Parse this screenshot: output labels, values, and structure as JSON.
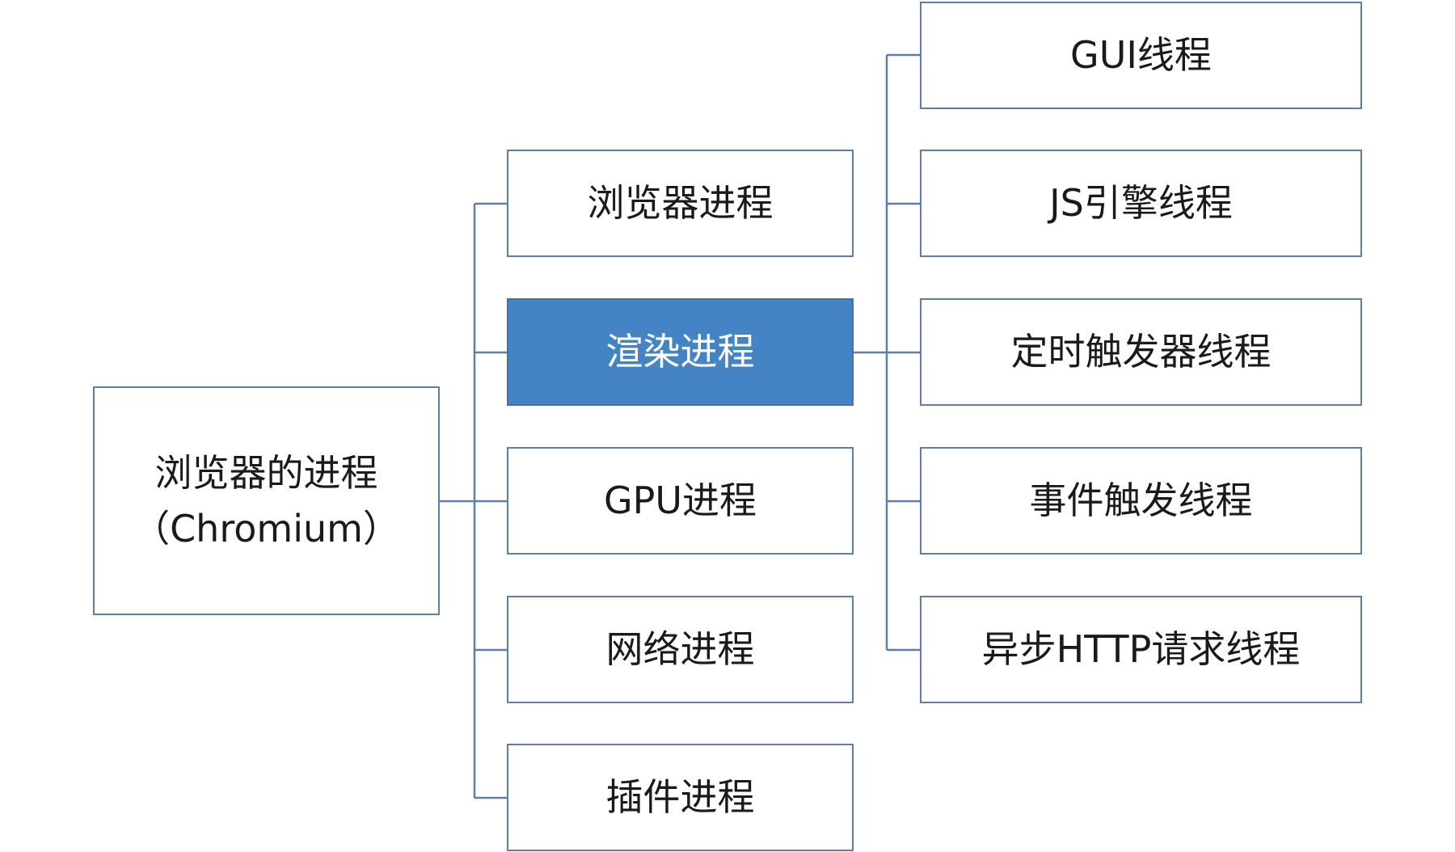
{
  "diagram": {
    "root": {
      "line1": "浏览器的进程",
      "line2": "（Chromium）"
    },
    "processes": [
      {
        "label": "浏览器进程"
      },
      {
        "label": "渲染进程",
        "highlighted": true
      },
      {
        "label": "GPU进程"
      },
      {
        "label": "网络进程"
      },
      {
        "label": "插件进程"
      }
    ],
    "threads": [
      {
        "label": "GUI线程"
      },
      {
        "label": "JS引擎线程"
      },
      {
        "label": "定时触发器线程"
      },
      {
        "label": "事件触发线程"
      },
      {
        "label": "异步HTTP请求线程"
      }
    ],
    "colors": {
      "border": "#5b7fa6",
      "connector": "#5b7fa6",
      "highlight_fill": "#4484c4",
      "highlight_text": "#ffffff",
      "text": "#1a1a1a"
    }
  }
}
